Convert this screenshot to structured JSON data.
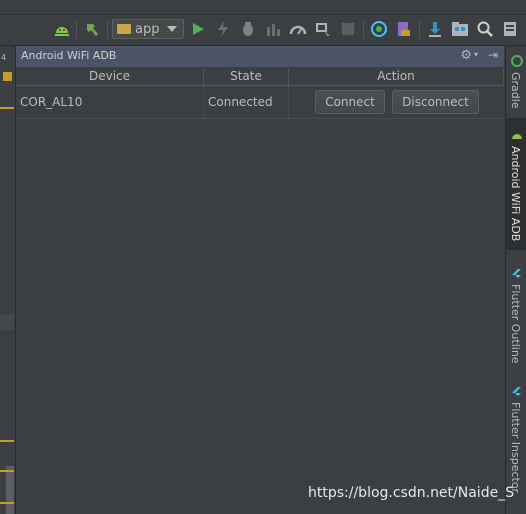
{
  "toolbar": {
    "run_config": "app",
    "icons": [
      "android-sync-icon",
      "hammer-icon",
      "run-icon",
      "apply-changes-icon",
      "debug-icon",
      "attach-debugger-icon",
      "profiler-icon",
      "avd-manager-icon",
      "stop-icon",
      "wifi-adb-icon",
      "sdk-manager-icon",
      "device-explorer-icon",
      "project-structure-icon",
      "search-icon",
      "more-icon"
    ]
  },
  "left_strip": {
    "label": "4"
  },
  "tool_window": {
    "title": "Android WiFi ADB",
    "table": {
      "headers": [
        "Device",
        "State",
        "Action"
      ],
      "rows": [
        {
          "device": "COR_AL10",
          "state": "Connected",
          "connect_label": "Connect",
          "disconnect_label": "Disconnect"
        }
      ]
    }
  },
  "right_tabs": [
    {
      "label": "Gradle",
      "icon": "gradle-icon"
    },
    {
      "label": "Android WiFi ADB",
      "icon": "android-icon"
    },
    {
      "label": "Flutter Outline",
      "icon": "flutter-icon"
    },
    {
      "label": "Flutter Inspector",
      "icon": "flutter-icon"
    }
  ],
  "watermark": "https://blog.csdn.net/Naide_S",
  "colors": {
    "background": "#3c3f41",
    "header_bar": "#4b5366",
    "accent_green": "#4caf50",
    "flutter_blue": "#40c4ff",
    "marker_yellow": "#c99c26"
  }
}
